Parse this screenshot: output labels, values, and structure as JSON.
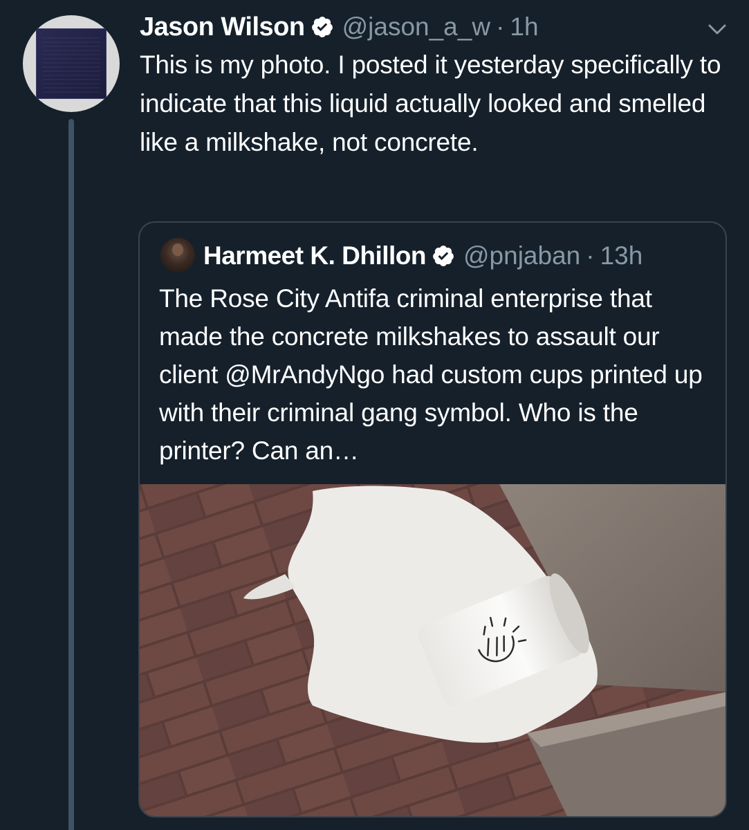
{
  "tweet": {
    "author_name": "Jason Wilson",
    "author_handle": "@jason_a_w",
    "separator": "·",
    "time": "1h",
    "text": "This is my photo. I posted it yesterday specifically to indicate that this liquid actually looked and smelled like a milkshake, not concrete.",
    "icons": {
      "verified": "verified-badge-icon",
      "menu": "chevron-down-icon"
    }
  },
  "quoted_tweet": {
    "author_name": "Harmeet K. Dhillon",
    "author_handle": "@pnjaban",
    "separator": "·",
    "time": "13h",
    "text": "The Rose City Antifa criminal enterprise that made the concrete milkshakes to assault our client @MrAndyNgo had custom cups printed up with their criminal gang symbol. Who is the printer? Can an…"
  },
  "colors": {
    "background": "#15202b",
    "text": "#ffffff",
    "secondary_text": "#8899a6",
    "border": "#38444d",
    "verified": "#ffffff"
  }
}
